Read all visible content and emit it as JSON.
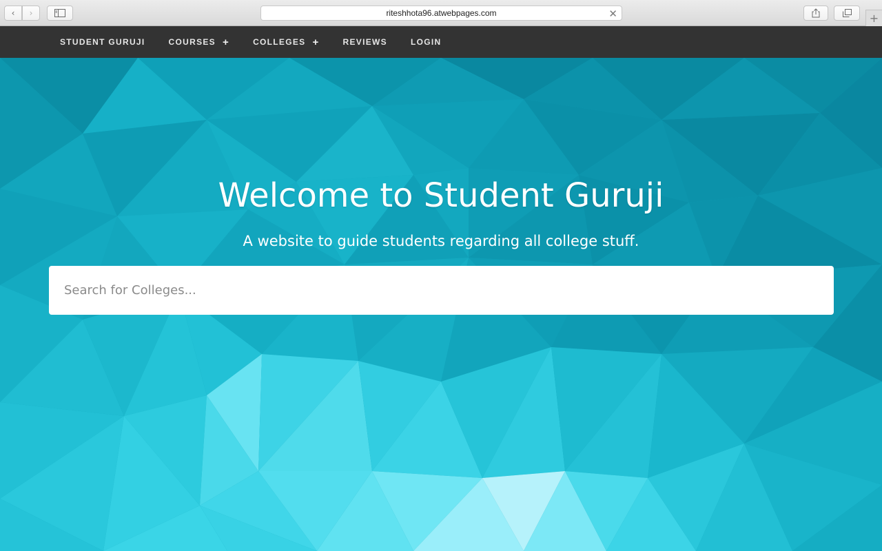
{
  "browser": {
    "url": "riteshhota96.atwebpages.com",
    "icons": {
      "back": "chevron-left-icon",
      "forward": "chevron-right-icon",
      "sidebar": "sidebar-icon",
      "clear": "close-icon",
      "share": "share-icon",
      "tabs": "tabs-icon",
      "new_tab": "plus-icon"
    }
  },
  "nav": {
    "items": [
      {
        "label": "STUDENT GURUJI"
      },
      {
        "label": "COURSES",
        "expand": "+"
      },
      {
        "label": "COLLEGES",
        "expand": "+"
      },
      {
        "label": "REVIEWS"
      },
      {
        "label": "LOGIN"
      }
    ]
  },
  "hero": {
    "title": "Welcome to Student Guruji",
    "subtitle": "A website to guide students regarding all college stuff.",
    "search_placeholder": "Search for Colleges..."
  },
  "colors": {
    "nav_bg": "#333333",
    "hero_base": "#14a6bd",
    "hero_light": "#7fe9f7",
    "hero_dark": "#087c92"
  }
}
